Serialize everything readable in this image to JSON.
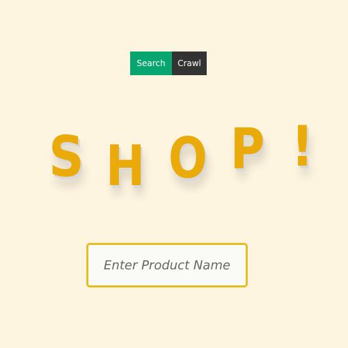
{
  "nav": {
    "tabs": [
      {
        "label": "Search"
      },
      {
        "label": "Crawl"
      }
    ]
  },
  "hero": {
    "letters": [
      "S",
      "H",
      "O",
      "P",
      "!"
    ]
  },
  "search": {
    "value": "",
    "placeholder": "Enter Product Name"
  },
  "colors": {
    "background": "#FEF5E1",
    "search_tab": "#07A56F",
    "crawl_tab": "#333333",
    "headline": "#EAAA0A",
    "input_border": "#E5BD24"
  }
}
